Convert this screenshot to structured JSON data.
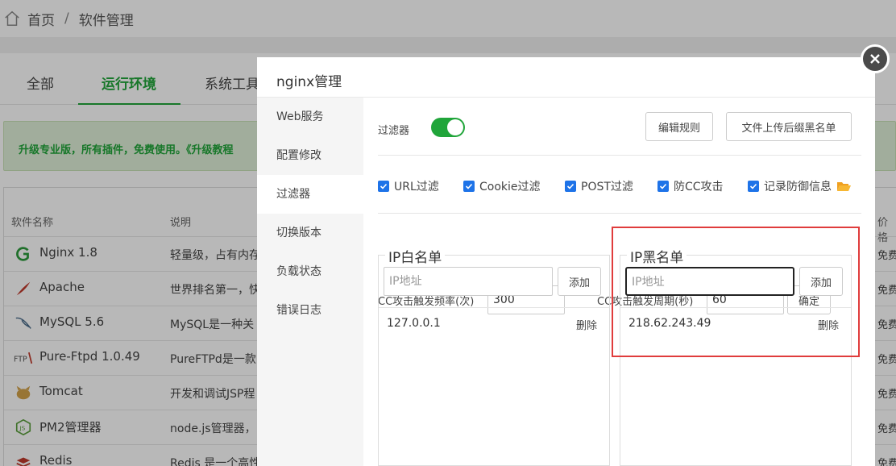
{
  "breadcrumb": {
    "home": "首页",
    "separator": "/",
    "current": "软件管理"
  },
  "background": {
    "tabs": [
      "全部",
      "运行环境",
      "系统工具"
    ],
    "promo": "升级专业版，所有插件，免费使用。《升级教程",
    "table_headers": {
      "name": "软件名称",
      "desc": "说明",
      "price": "价格"
    },
    "rows": [
      {
        "name": "Nginx 1.8",
        "desc": "轻量级，占有内存",
        "price": "免费",
        "icon": "nginx-icon"
      },
      {
        "name": "Apache",
        "desc": "世界排名第一，快",
        "price": "免费",
        "icon": "apache-feather-icon"
      },
      {
        "name": "MySQL 5.6",
        "desc": "MySQL是一种关",
        "price": "免费",
        "icon": "mysql-dolphin-icon"
      },
      {
        "name": "Pure-Ftpd 1.0.49",
        "desc": "PureFTPd是一款",
        "price": "免费",
        "icon": "ftp-icon"
      },
      {
        "name": "Tomcat",
        "desc": "开发和调试JSP程",
        "price": "免费",
        "icon": "tomcat-icon"
      },
      {
        "name": "PM2管理器",
        "desc": "node.js管理器，",
        "price": "免费",
        "icon": "nodejs-icon"
      },
      {
        "name": "Redis",
        "desc": "Redis 是一个高性",
        "price": "免费",
        "icon": "redis-icon"
      }
    ]
  },
  "modal": {
    "title": "nginx管理",
    "nav": [
      "Web服务",
      "配置修改",
      "过滤器",
      "切换版本",
      "负载状态",
      "错误日志"
    ],
    "active_nav": 2,
    "filter_label": "过滤器",
    "filter_enabled": true,
    "edit_rules_button": "编辑规则",
    "suffix_blacklist_button": "文件上传后缀黑名单",
    "checkboxes": [
      "URL过滤",
      "Cookie过滤",
      "POST过滤",
      "防CC攻击",
      "记录防御信息"
    ],
    "cc_freq_label": "CC攻击触发频率(次)",
    "cc_freq_value": "300",
    "cc_period_label": "CC攻击触发周期(秒)",
    "cc_period_value": "60",
    "confirm_button": "确定",
    "whitelist": {
      "title": "IP白名单",
      "placeholder": "IP地址",
      "add_button": "添加",
      "entries": [
        {
          "ip": "127.0.0.1",
          "delete": "删除"
        }
      ]
    },
    "blacklist": {
      "title": "IP黑名单",
      "placeholder": "IP地址",
      "add_button": "添加",
      "entries": [
        {
          "ip": "218.62.243.49",
          "delete": "删除"
        }
      ]
    }
  },
  "colors": {
    "accent": "#20a53a",
    "checkbox": "#1e73e8",
    "highlight": "#e03c3c"
  }
}
